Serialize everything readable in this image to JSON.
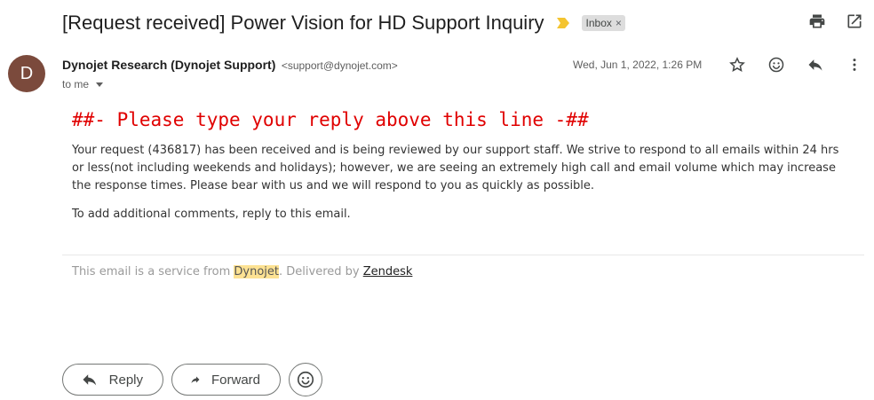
{
  "email": {
    "subject": "[Request received] Power Vision for HD Support Inquiry",
    "label": "Inbox",
    "label_remove": "×",
    "sender": {
      "initial": "D",
      "name": "Dynojet Research (Dynojet Support)",
      "email": "<support@dynojet.com>",
      "recipient": "to me"
    },
    "date": "Wed, Jun 1, 2022, 1:26 PM",
    "body": {
      "reply_line": "##- Please type your reply above this line -##",
      "paragraph1": "Your request (436817) has been received and is being reviewed by our support staff. We strive to respond to all emails within 24 hrs or less(not including weekends and holidays); however, we are seeing an extremely high call and email volume which may increase the response times. Please bear with us and we will respond to you as quickly as possible.",
      "paragraph2": "To add additional comments, reply to this email."
    },
    "footer": {
      "prefix": "This email is a service from ",
      "brand": "Dynojet",
      "middle": ". Delivered by ",
      "link": "Zendesk"
    }
  },
  "actions": {
    "reply_label": "Reply",
    "forward_label": "Forward"
  },
  "colors": {
    "avatar_bg": "#7b4a3c",
    "importance_marker": "#f4c430",
    "reply_line": "#e00000",
    "highlight": "#fde293"
  },
  "icons": [
    "importance-marker-icon",
    "print-icon",
    "open-in-new-window-icon",
    "star-icon",
    "emoji-icon",
    "reply-icon",
    "more-vert-icon",
    "forward-icon"
  ]
}
